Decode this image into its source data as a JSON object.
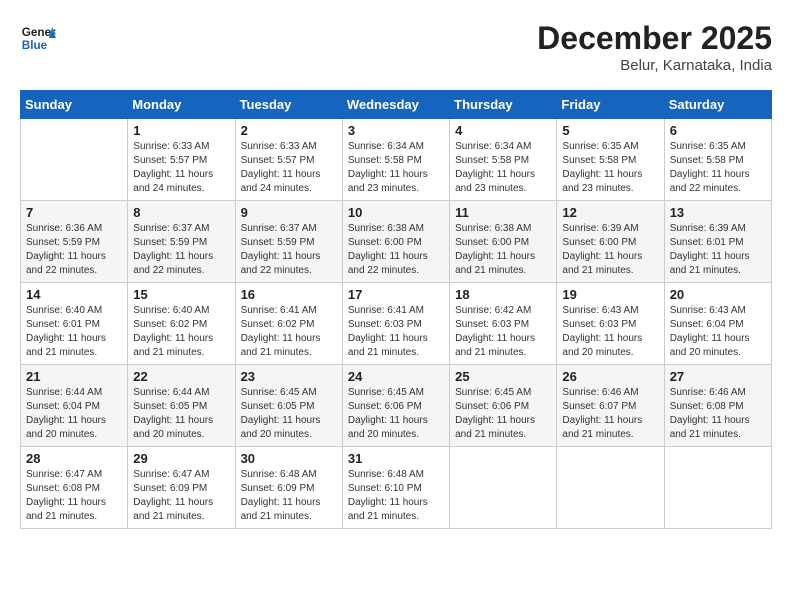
{
  "header": {
    "logo_line1": "General",
    "logo_line2": "Blue",
    "month": "December 2025",
    "location": "Belur, Karnataka, India"
  },
  "weekdays": [
    "Sunday",
    "Monday",
    "Tuesday",
    "Wednesday",
    "Thursday",
    "Friday",
    "Saturday"
  ],
  "weeks": [
    [
      {
        "day": "",
        "info": ""
      },
      {
        "day": "1",
        "info": "Sunrise: 6:33 AM\nSunset: 5:57 PM\nDaylight: 11 hours\nand 24 minutes."
      },
      {
        "day": "2",
        "info": "Sunrise: 6:33 AM\nSunset: 5:57 PM\nDaylight: 11 hours\nand 24 minutes."
      },
      {
        "day": "3",
        "info": "Sunrise: 6:34 AM\nSunset: 5:58 PM\nDaylight: 11 hours\nand 23 minutes."
      },
      {
        "day": "4",
        "info": "Sunrise: 6:34 AM\nSunset: 5:58 PM\nDaylight: 11 hours\nand 23 minutes."
      },
      {
        "day": "5",
        "info": "Sunrise: 6:35 AM\nSunset: 5:58 PM\nDaylight: 11 hours\nand 23 minutes."
      },
      {
        "day": "6",
        "info": "Sunrise: 6:35 AM\nSunset: 5:58 PM\nDaylight: 11 hours\nand 22 minutes."
      }
    ],
    [
      {
        "day": "7",
        "info": "Sunrise: 6:36 AM\nSunset: 5:59 PM\nDaylight: 11 hours\nand 22 minutes."
      },
      {
        "day": "8",
        "info": "Sunrise: 6:37 AM\nSunset: 5:59 PM\nDaylight: 11 hours\nand 22 minutes."
      },
      {
        "day": "9",
        "info": "Sunrise: 6:37 AM\nSunset: 5:59 PM\nDaylight: 11 hours\nand 22 minutes."
      },
      {
        "day": "10",
        "info": "Sunrise: 6:38 AM\nSunset: 6:00 PM\nDaylight: 11 hours\nand 22 minutes."
      },
      {
        "day": "11",
        "info": "Sunrise: 6:38 AM\nSunset: 6:00 PM\nDaylight: 11 hours\nand 21 minutes."
      },
      {
        "day": "12",
        "info": "Sunrise: 6:39 AM\nSunset: 6:00 PM\nDaylight: 11 hours\nand 21 minutes."
      },
      {
        "day": "13",
        "info": "Sunrise: 6:39 AM\nSunset: 6:01 PM\nDaylight: 11 hours\nand 21 minutes."
      }
    ],
    [
      {
        "day": "14",
        "info": "Sunrise: 6:40 AM\nSunset: 6:01 PM\nDaylight: 11 hours\nand 21 minutes."
      },
      {
        "day": "15",
        "info": "Sunrise: 6:40 AM\nSunset: 6:02 PM\nDaylight: 11 hours\nand 21 minutes."
      },
      {
        "day": "16",
        "info": "Sunrise: 6:41 AM\nSunset: 6:02 PM\nDaylight: 11 hours\nand 21 minutes."
      },
      {
        "day": "17",
        "info": "Sunrise: 6:41 AM\nSunset: 6:03 PM\nDaylight: 11 hours\nand 21 minutes."
      },
      {
        "day": "18",
        "info": "Sunrise: 6:42 AM\nSunset: 6:03 PM\nDaylight: 11 hours\nand 21 minutes."
      },
      {
        "day": "19",
        "info": "Sunrise: 6:43 AM\nSunset: 6:03 PM\nDaylight: 11 hours\nand 20 minutes."
      },
      {
        "day": "20",
        "info": "Sunrise: 6:43 AM\nSunset: 6:04 PM\nDaylight: 11 hours\nand 20 minutes."
      }
    ],
    [
      {
        "day": "21",
        "info": "Sunrise: 6:44 AM\nSunset: 6:04 PM\nDaylight: 11 hours\nand 20 minutes."
      },
      {
        "day": "22",
        "info": "Sunrise: 6:44 AM\nSunset: 6:05 PM\nDaylight: 11 hours\nand 20 minutes."
      },
      {
        "day": "23",
        "info": "Sunrise: 6:45 AM\nSunset: 6:05 PM\nDaylight: 11 hours\nand 20 minutes."
      },
      {
        "day": "24",
        "info": "Sunrise: 6:45 AM\nSunset: 6:06 PM\nDaylight: 11 hours\nand 20 minutes."
      },
      {
        "day": "25",
        "info": "Sunrise: 6:45 AM\nSunset: 6:06 PM\nDaylight: 11 hours\nand 21 minutes."
      },
      {
        "day": "26",
        "info": "Sunrise: 6:46 AM\nSunset: 6:07 PM\nDaylight: 11 hours\nand 21 minutes."
      },
      {
        "day": "27",
        "info": "Sunrise: 6:46 AM\nSunset: 6:08 PM\nDaylight: 11 hours\nand 21 minutes."
      }
    ],
    [
      {
        "day": "28",
        "info": "Sunrise: 6:47 AM\nSunset: 6:08 PM\nDaylight: 11 hours\nand 21 minutes."
      },
      {
        "day": "29",
        "info": "Sunrise: 6:47 AM\nSunset: 6:09 PM\nDaylight: 11 hours\nand 21 minutes."
      },
      {
        "day": "30",
        "info": "Sunrise: 6:48 AM\nSunset: 6:09 PM\nDaylight: 11 hours\nand 21 minutes."
      },
      {
        "day": "31",
        "info": "Sunrise: 6:48 AM\nSunset: 6:10 PM\nDaylight: 11 hours\nand 21 minutes."
      },
      {
        "day": "",
        "info": ""
      },
      {
        "day": "",
        "info": ""
      },
      {
        "day": "",
        "info": ""
      }
    ]
  ]
}
